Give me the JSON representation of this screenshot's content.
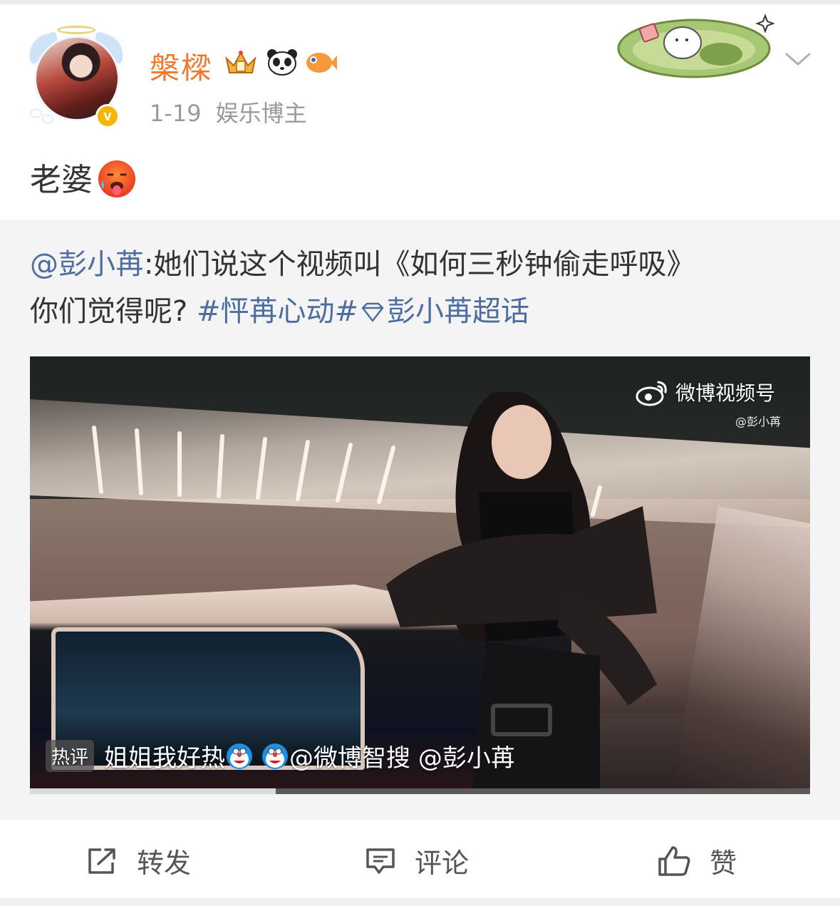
{
  "post": {
    "username": "槃樑",
    "date": "1-19",
    "source": "娱乐博主",
    "verified_label": "v",
    "text": "老婆",
    "badges": [
      "crown-badge-icon",
      "panda-badge-icon",
      "fish-badge-icon"
    ]
  },
  "retweet": {
    "mention": "@彭小苒",
    "text_part1": ":她们说这个视频叫《如何三秒钟偷走呼吸》",
    "text_part2": "你们觉得呢?",
    "topic": "#怦苒心动#",
    "super_topic": "彭小苒超话"
  },
  "video": {
    "watermark_title": "微博视频号",
    "watermark_user": "@彭小苒",
    "hot_comment_tag": "热评",
    "hot_comment_text": "姐姐我好热",
    "hot_comment_mentions": "@微博智搜 @彭小苒",
    "progress": 0.315
  },
  "actions": {
    "repost_label": "转发",
    "comment_label": "评论",
    "like_label": "赞"
  },
  "colors": {
    "username": "#f0782c",
    "link": "#4d6d9e",
    "verified": "#f7b500",
    "retweet_bg": "#f4f4f4"
  }
}
